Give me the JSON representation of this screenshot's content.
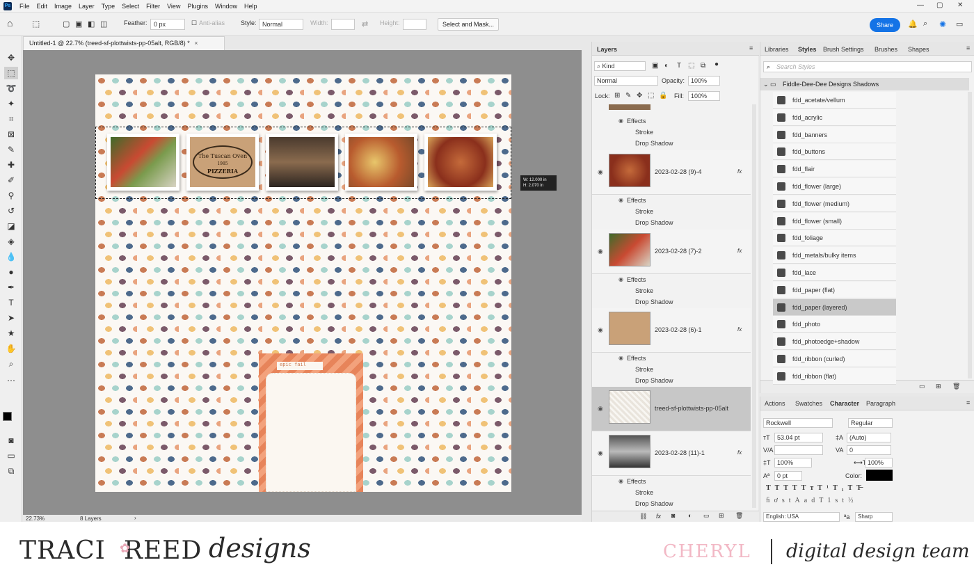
{
  "menubar": {
    "app_icon": "Ps",
    "items": [
      "File",
      "Edit",
      "Image",
      "Layer",
      "Type",
      "Select",
      "Filter",
      "View",
      "Plugins",
      "Window",
      "Help"
    ],
    "window_controls": [
      "—",
      "▢",
      "✕"
    ]
  },
  "options": {
    "feather_label": "Feather:",
    "feather_value": "0 px",
    "anti_alias_label": "Anti-alias",
    "style_label": "Style:",
    "style_value": "Normal",
    "width_label": "Width:",
    "height_label": "Height:",
    "select_mask_label": "Select and Mask...",
    "share_label": "Share"
  },
  "document": {
    "tab_title": "Untitled-1 @ 22.7% (treed-sf-plottwists-pp-05alt, RGB/8) *",
    "zoom": "22.73%",
    "layers_count": "8 Layers",
    "measure_w": "W: 12.000 in",
    "measure_h": "H: 2.070 in",
    "card_tag": "epic fail",
    "pizzeria_line1": "The Tuscan Oven",
    "pizzeria_line2": "PIZZERIA",
    "pizzeria_year": "1985"
  },
  "layers_panel": {
    "title": "Layers",
    "kind_label": "Kind",
    "blend_mode": "Normal",
    "opacity_label": "Opacity:",
    "opacity_value": "100%",
    "lock_label": "Lock:",
    "fill_label": "Fill:",
    "fill_value": "100%",
    "effects_label": "Effects",
    "stroke_label": "Stroke",
    "drop_shadow_label": "Drop Shadow",
    "fx_label": "fx",
    "layers": [
      {
        "name": "2023-02-28 (9)-4"
      },
      {
        "name": "2023-02-28 (7)-2"
      },
      {
        "name": "2023-02-28 (6)-1"
      },
      {
        "name": "treed-sf-plottwists-pp-05alt"
      },
      {
        "name": "2023-02-28 (11)-1"
      }
    ]
  },
  "styles_panel": {
    "tabs": [
      "Libraries",
      "Styles",
      "Brush Settings",
      "Brushes",
      "Shapes"
    ],
    "search_placeholder": "Search Styles",
    "group_name": "Fiddle-Dee-Dee Designs Shadows",
    "items": [
      "fdd_acetate/vellum",
      "fdd_acrylic",
      "fdd_banners",
      "fdd_buttons",
      "fdd_flair",
      "fdd_flower (large)",
      "fdd_flower (medium)",
      "fdd_flower (small)",
      "fdd_foliage",
      "fdd_metals/bulky items",
      "fdd_lace",
      "fdd_paper (flat)",
      "fdd_paper (layered)",
      "fdd_photo",
      "fdd_photoedge+shadow",
      "fdd_ribbon (curled)",
      "fdd_ribbon (flat)"
    ],
    "highlighted_index": 12
  },
  "character_panel": {
    "tabs": [
      "Actions",
      "Swatches",
      "Character",
      "Paragraph"
    ],
    "font_family": "Rockwell",
    "font_style": "Regular",
    "font_size": "53.04 pt",
    "leading": "(Auto)",
    "tracking": "0",
    "vertical_scale": "100%",
    "horizontal_scale": "100%",
    "baseline_shift": "0 pt",
    "color_label": "Color:",
    "language": "English: USA",
    "antialias": "Sharp",
    "type_buttons": [
      "T",
      "T",
      "TT",
      "Tт",
      "T¹",
      "T₁",
      "T",
      "T̶"
    ],
    "opentype_buttons": [
      "ﬁ",
      "ơ",
      "st",
      "A",
      "ad",
      "T",
      "1st",
      "½"
    ]
  },
  "footer": {
    "brand_left": "TRACI",
    "brand_right": "REED",
    "brand_script": "designs",
    "designer": "CHERYL",
    "team": "digital design team"
  },
  "colors": {
    "accent": "#1473e6",
    "canvas_bg": "#8e8e8e",
    "designer_pink": "#f2b8c5"
  }
}
